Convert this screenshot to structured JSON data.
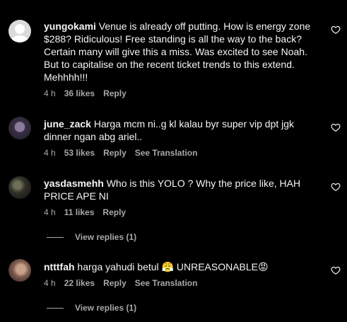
{
  "comments": [
    {
      "username": "yungokami",
      "text": " Venue is already off putting. How is energy zone $288? Ridiculous! Free standing is all the way to the back? Certain many will give this a miss. Was excited to see Noah. But to capitalise on the recent ticket trends to this extend. Mehhhh!!!",
      "time": "4 h",
      "likes": "36 likes",
      "reply": "Reply"
    },
    {
      "username": "june_zack",
      "text": " Harga mcm ni..g kl kalau byr super vip dpt jgk dinner ngan abg ariel..",
      "time": "4 h",
      "likes": "53 likes",
      "reply": "Reply",
      "translate": "See Translation"
    },
    {
      "username": "yasdasmehh",
      "text": " Who is this YOLO ? Why the price like, HAH PRICE APE NI",
      "time": "4 h",
      "likes": "11 likes",
      "reply": "Reply",
      "view_replies": "View replies (1)"
    },
    {
      "username": "ntttfah",
      "text_before": " harga yahudi betul ",
      "emoji1": "😤",
      "text_after": " UNREASONABLE",
      "emoji2": "😡",
      "time": "4 h",
      "likes": "22 likes",
      "reply": "Reply",
      "translate": "See Translation",
      "view_replies": "View replies (1)"
    }
  ],
  "icons": {
    "like": "heart-outline-icon"
  }
}
